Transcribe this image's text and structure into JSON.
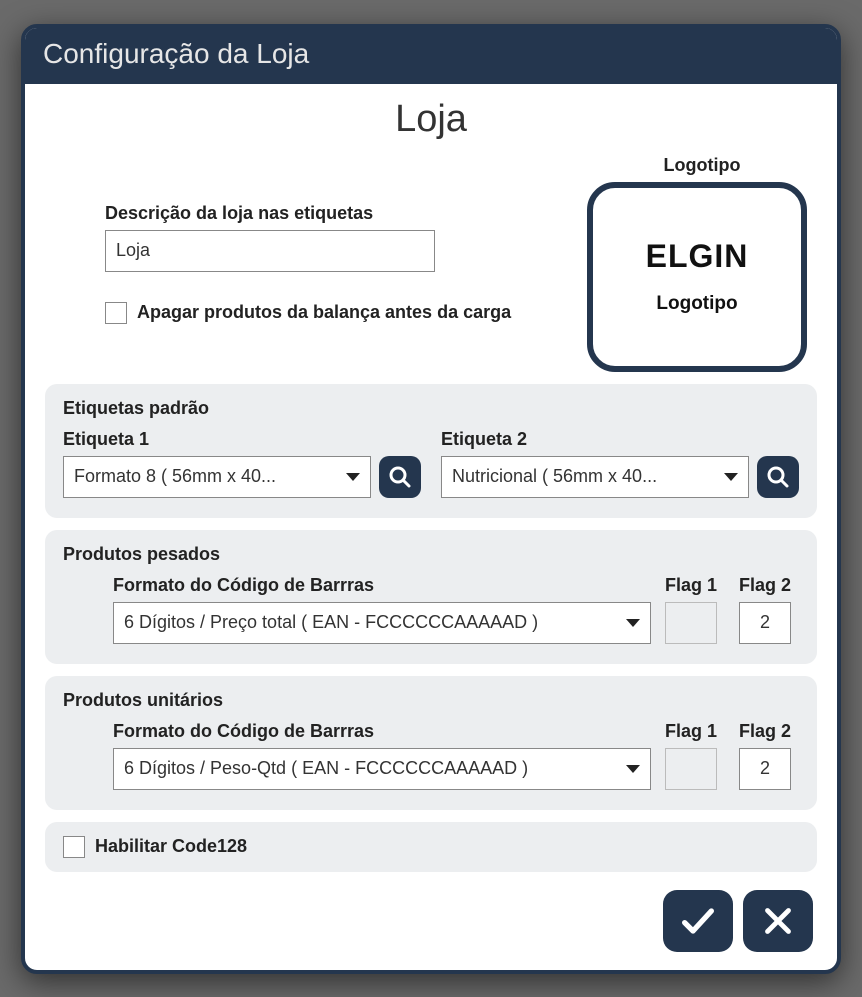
{
  "window": {
    "title": "Configuração da Loja"
  },
  "page_title": "Loja",
  "desc": {
    "label": "Descrição da loja nas etiquetas",
    "value": "Loja"
  },
  "clear_products": {
    "label": "Apagar produtos da balança antes da carga",
    "checked": false
  },
  "logo": {
    "title": "Logotipo",
    "brand": "ELGIN",
    "caption": "Logotipo"
  },
  "etiquetas": {
    "panel_title": "Etiquetas padrão",
    "etq1": {
      "label": "Etiqueta 1",
      "value": "Formato 8 ( 56mm x 40..."
    },
    "etq2": {
      "label": "Etiqueta 2",
      "value": "Nutricional ( 56mm x 40..."
    }
  },
  "pesados": {
    "panel_title": "Produtos pesados",
    "format_label": "Formato do Código de Barrras",
    "format_value": "6 Dígitos / Preço total ( EAN - FCCCCCCAAAAAD )",
    "flag1_label": "Flag 1",
    "flag1_value": "",
    "flag2_label": "Flag 2",
    "flag2_value": "2"
  },
  "unitarios": {
    "panel_title": "Produtos unitários",
    "format_label": "Formato do Código de Barrras",
    "format_value": "6 Dígitos / Peso-Qtd ( EAN - FCCCCCCAAAAAD )",
    "flag1_label": "Flag 1",
    "flag1_value": "",
    "flag2_label": "Flag 2",
    "flag2_value": "2"
  },
  "code128": {
    "label": "Habilitar Code128",
    "checked": false
  }
}
